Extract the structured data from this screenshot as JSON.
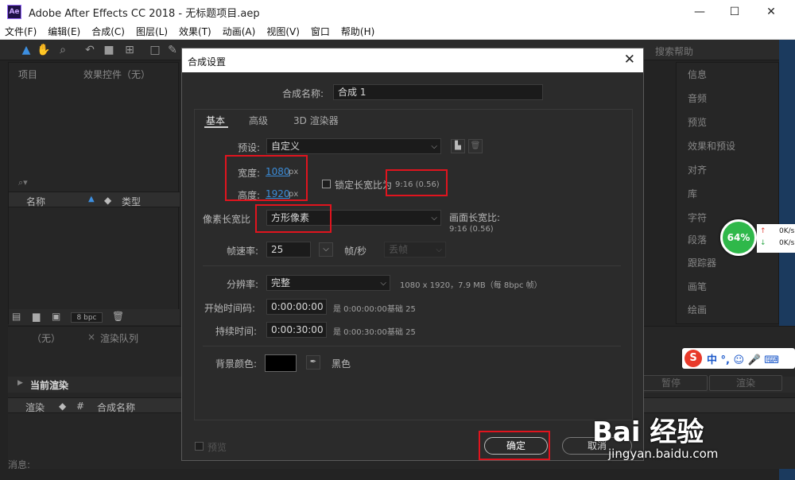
{
  "window": {
    "logo_text": "Ae",
    "title": "Adobe After Effects CC 2018 - 无标题项目.aep",
    "minimize": "—",
    "maximize": "☐",
    "close": "✕"
  },
  "menu": [
    "文件(F)",
    "编辑(E)",
    "合成(C)",
    "图层(L)",
    "效果(T)",
    "动画(A)",
    "视图(V)",
    "窗口",
    "帮助(H)"
  ],
  "toolbar": {
    "search_help": "搜索帮助"
  },
  "project_panel": {
    "tab_project": "项目",
    "tab_effects": "效果控件（无）",
    "col_name": "名称",
    "col_type": "类型",
    "bpc": "8 bpc"
  },
  "render_queue": {
    "tab_none": "（无）",
    "tab_render": "渲染队列",
    "current_render": "当前渲染",
    "col_render": "渲染",
    "col_hash": "#",
    "col_comp_name": "合成名称",
    "pause": "暂停",
    "render": "渲染"
  },
  "status": {
    "message": "消息:"
  },
  "right_panel": {
    "items": [
      "信息",
      "音频",
      "预览",
      "效果和预设",
      "对齐",
      "库",
      "字符",
      "段落",
      "跟踪器",
      "画笔",
      "绘画"
    ]
  },
  "dialog": {
    "title": "合成设置",
    "comp_name_label": "合成名称:",
    "comp_name": "合成 1",
    "tabs": [
      "基本",
      "高级",
      "3D 渲染器"
    ],
    "preset_label": "预设:",
    "preset_value": "自定义",
    "width_label": "宽度:",
    "width_value": "1080",
    "height_label": "高度:",
    "height_value": "1920",
    "px": "px",
    "lock_aspect_label": "锁定长宽比为",
    "lock_aspect_value": "9:16 (0.56)",
    "pixel_aspect_label": "像素长宽比",
    "pixel_aspect_value": "方形像素",
    "frame_aspect_label": "画面长宽比:",
    "frame_aspect_value": "9:16 (0.56)",
    "frame_rate_label": "帧速率:",
    "frame_rate_value": "25",
    "fps_unit": "帧/秒",
    "drop_frame": "丢帧",
    "resolution_label": "分辨率:",
    "resolution_value": "完整",
    "resolution_info": "1080 x 1920，7.9 MB（每 8bpc 帧）",
    "start_tc_label": "开始时间码:",
    "start_tc_value": "0:00:00:00",
    "start_tc_info": "是 0:00:00:00",
    "base_label": "基础 25",
    "duration_label": "持续时间:",
    "duration_value": "0:00:30:00",
    "duration_info": "是 0:00:30:00",
    "bg_color_label": "背景颜色:",
    "bg_color_name": "黑色",
    "preview_label": "预览",
    "ok": "确定",
    "cancel": "取消"
  },
  "widgets": {
    "perf_percent": "64%",
    "net_up": "0K/s",
    "net_down": "0K/s",
    "ime_logo": "S",
    "ime_text": "中 °, ☺ 🎤 ⌨"
  },
  "watermark": {
    "brand": "Bai 经验",
    "url": "jingyan.baidu.com"
  }
}
